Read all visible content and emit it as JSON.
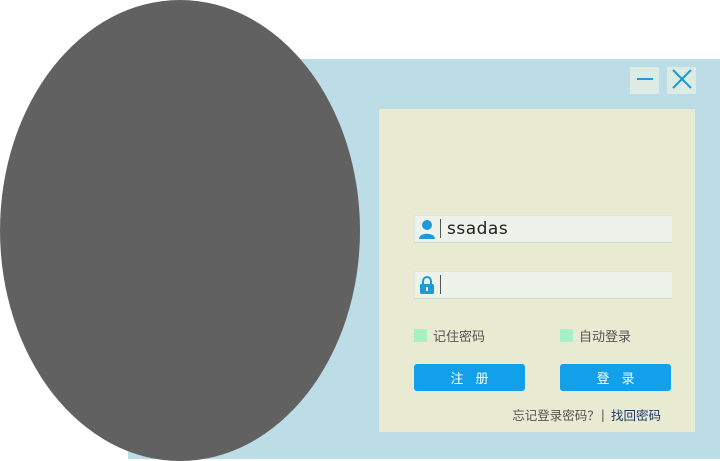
{
  "window": {
    "minimize_icon": "minimize-icon",
    "close_icon": "close-icon"
  },
  "login": {
    "username": {
      "icon": "user-icon",
      "value": "ssadas"
    },
    "password": {
      "icon": "lock-icon",
      "value": ""
    },
    "remember_password_label": "记住密码",
    "auto_login_label": "自动登录",
    "register_label": "注册",
    "login_label": "登录",
    "forgot_question": "忘记登录密码？",
    "separator": "|",
    "recover_link": "找回密码"
  },
  "colors": {
    "window_bg": "#bcdde6",
    "panel_bg": "#e8ead2",
    "accent": "#12a0ea",
    "checkbox": "#a9efc4",
    "avatar": "#616161"
  }
}
